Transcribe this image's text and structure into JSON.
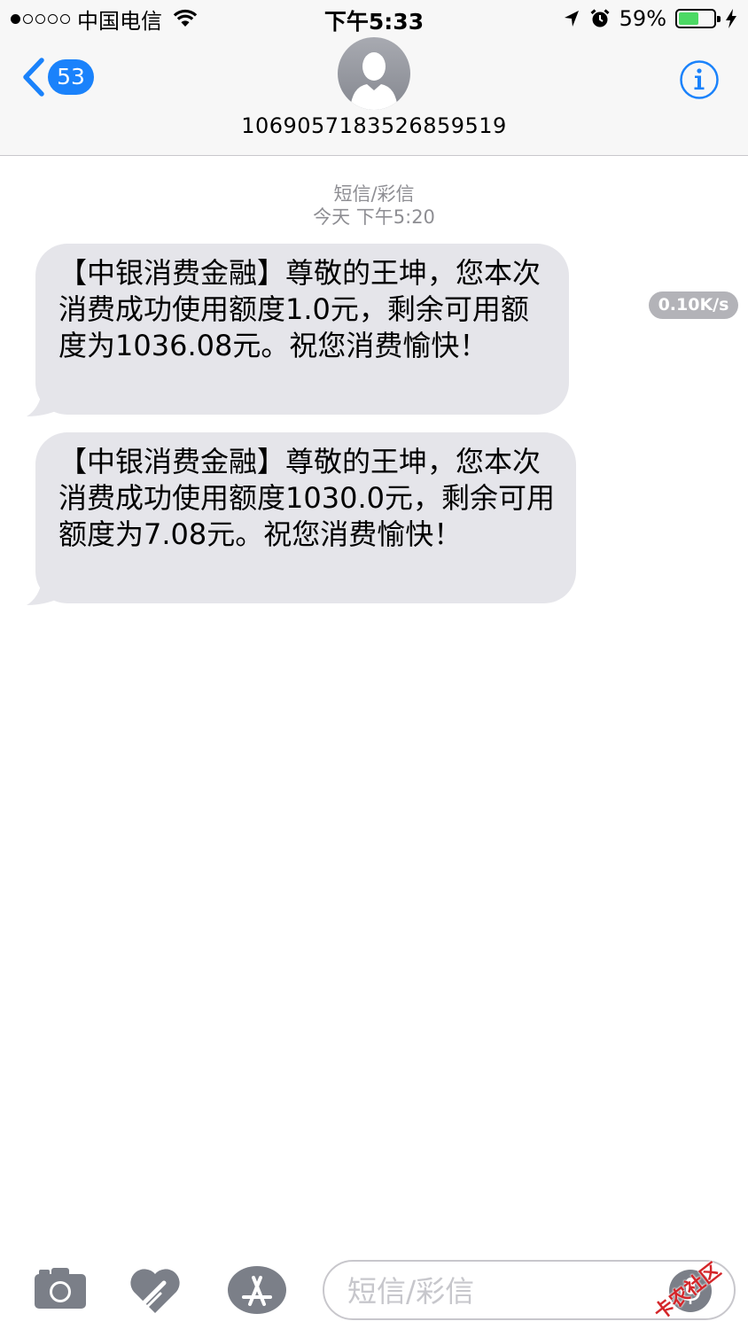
{
  "status_bar": {
    "carrier": "中国电信",
    "time": "下午5:33",
    "battery_percent": "59%",
    "battery_level": 0.59,
    "signal_strength": 1,
    "signal_total": 5
  },
  "header": {
    "back_count": "53",
    "contact_number": "1069057183526859519",
    "icons": [
      "back-chevron-icon",
      "person-avatar-icon",
      "info-icon"
    ]
  },
  "conversation": {
    "message_type": "短信/彩信",
    "timestamp": "今天 下午5:20",
    "download_speed": "0.10K/s",
    "messages": [
      {
        "text": "【中银消费金融】尊敬的王坤，您本次消费成功使用额度1.0元，剩余可用额度为1036.08元。祝您消费愉快！"
      },
      {
        "text": "【中银消费金融】尊敬的王坤，您本次消费成功使用额度1030.0元，剩余可用额度为7.08元。祝您消费愉快！"
      }
    ]
  },
  "input_bar": {
    "placeholder": "短信/彩信",
    "icons": [
      "camera-icon",
      "digital-touch-heart-icon",
      "app-store-icon",
      "microphone-icon"
    ]
  },
  "watermark": {
    "text": "卡农社区"
  },
  "colors": {
    "ios_blue": "#1a82fb",
    "bubble_gray": "#e5e5ea",
    "battery_green": "#4cd964",
    "meta_gray": "#8e8e93",
    "icon_gray": "#7b7f88",
    "watermark_red": "#d4262a"
  }
}
